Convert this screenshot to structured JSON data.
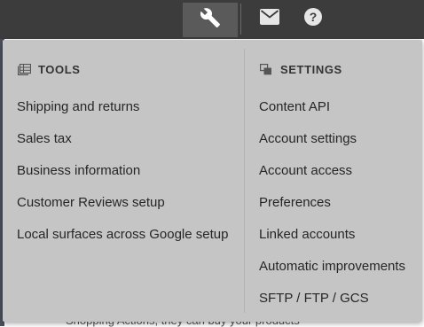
{
  "topbar": {
    "tools_icon": "wrench-icon",
    "mail_icon": "mail-icon",
    "help_icon": "help-icon",
    "active_button": "tools",
    "background_color": "#3c3c3c",
    "active_color": "#5a5a5a"
  },
  "menu": {
    "background_color": "#c5c5c5",
    "tools": {
      "icon": "tools-grid-icon",
      "title": "TOOLS",
      "items": [
        "Shipping and returns",
        "Sales tax",
        "Business information",
        "Customer Reviews setup",
        "Local surfaces across Google setup"
      ]
    },
    "settings": {
      "icon": "settings-stack-icon",
      "title": "SETTINGS",
      "items": [
        "Content API",
        "Account settings",
        "Account access",
        "Preferences",
        "Linked accounts",
        "Automatic improvements",
        "SFTP / FTP / GCS"
      ]
    }
  },
  "background_page": {
    "partial_text": "Shopping Actions, they can buy your products"
  }
}
